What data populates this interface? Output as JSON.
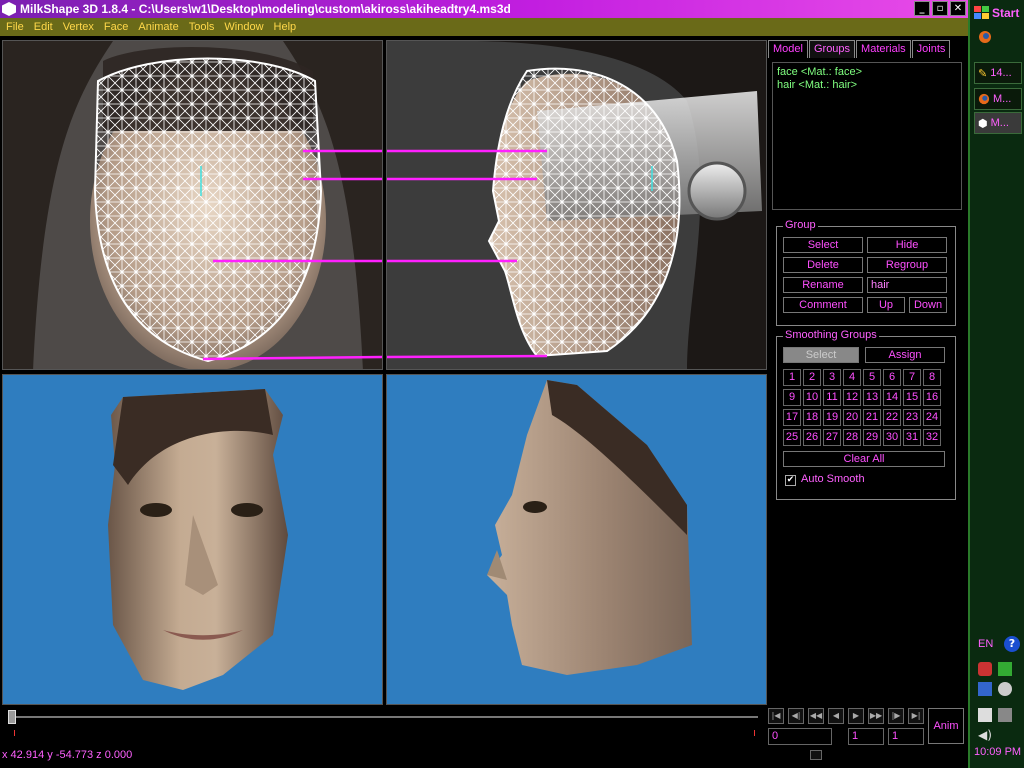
{
  "window": {
    "title": "MilkShape 3D 1.8.4 - C:\\Users\\w1\\Desktop\\modeling\\custom\\akiross\\akiheadtry4.ms3d",
    "buttons": {
      "minimize": "_",
      "restore": "▫",
      "close": "✕"
    }
  },
  "menu": [
    "File",
    "Edit",
    "Vertex",
    "Face",
    "Animate",
    "Tools",
    "Window",
    "Help"
  ],
  "panel": {
    "tabs": [
      "Model",
      "Groups",
      "Materials",
      "Joints"
    ],
    "active_tab": "Groups",
    "groups_list": [
      "face <Mat.: face>",
      "hair <Mat.: hair>"
    ],
    "group_box": {
      "legend": "Group",
      "select": "Select",
      "hide": "Hide",
      "delete": "Delete",
      "regroup": "Regroup",
      "rename": "Rename",
      "rename_value": "hair",
      "comment": "Comment",
      "up": "Up",
      "down": "Down"
    },
    "smoothing_box": {
      "legend": "Smoothing Groups",
      "select": "Select",
      "assign": "Assign",
      "numbers": [
        "1",
        "2",
        "3",
        "4",
        "5",
        "6",
        "7",
        "8",
        "9",
        "10",
        "11",
        "12",
        "13",
        "14",
        "15",
        "16",
        "17",
        "18",
        "19",
        "20",
        "21",
        "22",
        "23",
        "24",
        "25",
        "26",
        "27",
        "28",
        "29",
        "30",
        "31",
        "32"
      ],
      "clear_all": "Clear All",
      "auto_smooth": "Auto Smooth",
      "auto_smooth_checked": true
    }
  },
  "status": {
    "coords": "x 42.914 y -54.773 z 0.000"
  },
  "anim": {
    "button": "Anim",
    "frame_start": "0",
    "frame_current": "1",
    "frame_end": "1"
  },
  "taskbar": {
    "start": "Start",
    "tasks": [
      "14...",
      "M...",
      "M..."
    ],
    "language": "EN",
    "help": "?",
    "clock": "10:09 PM"
  },
  "colors": {
    "title_gradient_start": "#7a1fb0",
    "title_gradient_end": "#e94de8",
    "menu_bg": "#6a6a18",
    "menu_text": "#ffd84a",
    "panel_text": "#ff50ff",
    "list_text": "#80ff80",
    "viewport_3d_bg": "#2f7dbf",
    "reference_lines": "#ff20ff"
  }
}
